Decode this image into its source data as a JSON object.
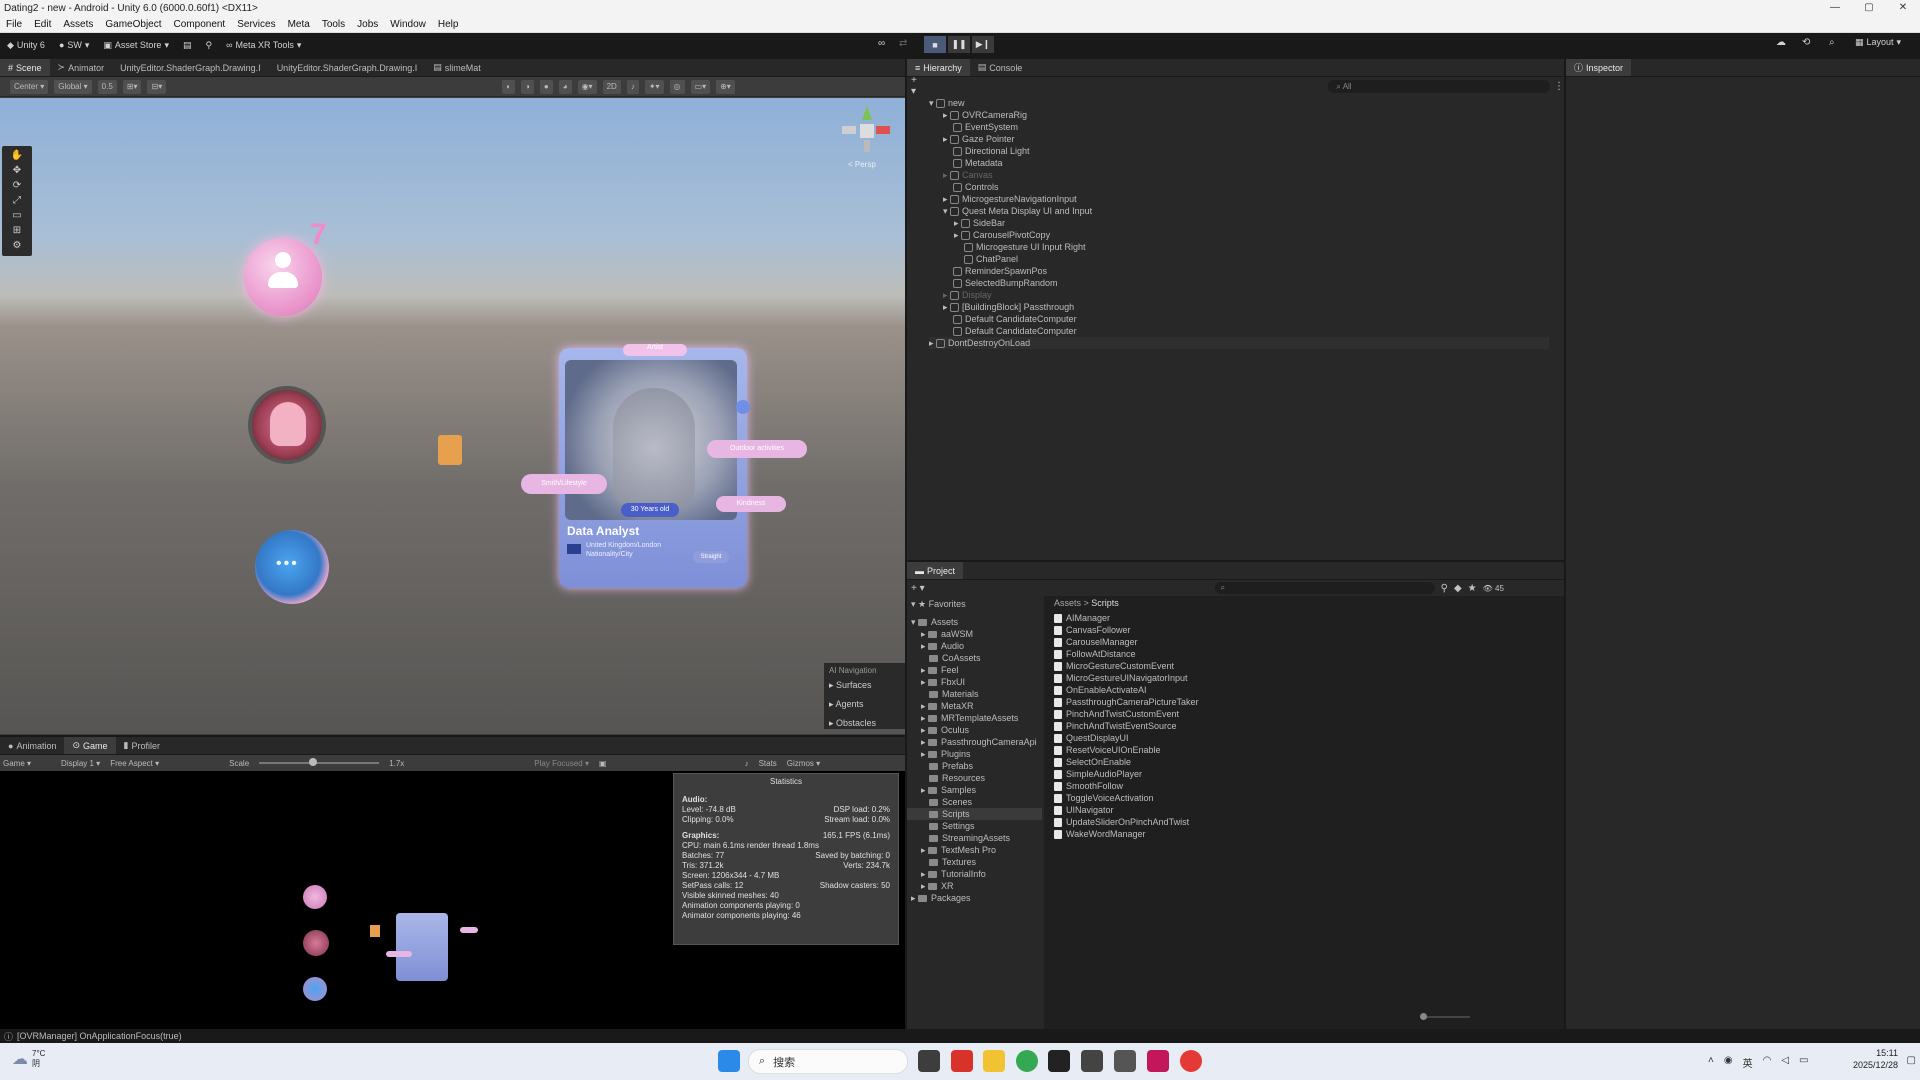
{
  "window": {
    "title": "Dating2 - new - Android - Unity 6.0 (6000.0.60f1) <DX11>",
    "controls": [
      "—",
      "▢",
      "✕"
    ]
  },
  "menu": [
    "File",
    "Edit",
    "Assets",
    "GameObject",
    "Component",
    "Services",
    "Meta",
    "Tools",
    "Jobs",
    "Window",
    "Help"
  ],
  "toolbar": {
    "unity": "Unity 6",
    "account": "SW",
    "asset_store": "Asset Store",
    "meta_xr": "Meta XR Tools",
    "layout": "Layout"
  },
  "scene_tabs": [
    "Scene",
    "Animator",
    "UnityEditor.ShaderGraph.Drawing.I",
    "UnityEditor.ShaderGraph.Drawing.I",
    "slimeMat"
  ],
  "scene_toolbar": {
    "center": "Center",
    "global": "Global",
    "snap": "0.5",
    "mode2d": "2D"
  },
  "gizmo": {
    "persp": "< Persp"
  },
  "scene": {
    "badge_number": "7",
    "card_title": "Data Analyst",
    "card_age": "30 Years old",
    "card_location": "United Kingdom/London",
    "card_nationality": "Nationality/City",
    "card_tag": "Smith/Lifestyle",
    "card_tag2": "Kindness",
    "card_button": "Straight",
    "card_top": "Artist",
    "chip_right": "Outdoor activities"
  },
  "ai_nav": {
    "title": "AI Navigation",
    "items": [
      "Surfaces",
      "Agents",
      "Obstacles"
    ]
  },
  "game_tabs": [
    "Animation",
    "Game",
    "Profiler"
  ],
  "game_toolbar": {
    "mode": "Game",
    "display": "Display 1",
    "aspect": "Free Aspect",
    "scale_label": "Scale",
    "scale_value": "1.7x",
    "play_focused": "Play Focused",
    "stats": "Stats",
    "gizmos": "Gizmos"
  },
  "stats": {
    "title": "Statistics",
    "audio_label": "Audio:",
    "level": "Level: -74.8 dB",
    "clipping": "Clipping: 0.0%",
    "dsp": "DSP load: 0.2%",
    "stream": "Stream load: 0.0%",
    "graphics_label": "Graphics:",
    "fps": "165.1 FPS (6.1ms)",
    "cpu": "CPU: main 6.1ms  render thread 1.8ms",
    "batches": "Batches: 77",
    "saved": "Saved by batching: 0",
    "tris": "Tris: 371.2k",
    "verts": "Verts: 234.7k",
    "screen": "Screen: 1206x344 - 4.7 MB",
    "setpass": "SetPass calls: 12",
    "shadow": "Shadow casters: 50",
    "skinned": "Visible skinned meshes: 40",
    "anim_comp": "Animation components playing: 0",
    "animator_comp": "Animator components playing: 46"
  },
  "hierarchy": {
    "tabs": [
      "Hierarchy",
      "Console"
    ],
    "search": "All",
    "items": [
      {
        "label": "new",
        "depth": 0
      },
      {
        "label": "OVRCameraRig",
        "depth": 1
      },
      {
        "label": "EventSystem",
        "depth": 1
      },
      {
        "label": "Gaze Pointer",
        "depth": 1
      },
      {
        "label": "Directional Light",
        "depth": 1
      },
      {
        "label": "Metadata",
        "depth": 1
      },
      {
        "label": "Canvas",
        "depth": 1
      },
      {
        "label": "Controls",
        "depth": 1
      },
      {
        "label": "MicrogestureNavigationInput",
        "depth": 1
      },
      {
        "label": "Quest Meta Display UI and Input",
        "depth": 1
      },
      {
        "label": "SideBar",
        "depth": 2
      },
      {
        "label": "CarouselPivotCopy",
        "depth": 2
      },
      {
        "label": "Microgesture UI Input Right",
        "depth": 2
      },
      {
        "label": "ChatPanel",
        "depth": 2
      },
      {
        "label": "ReminderSpawnPos",
        "depth": 1
      },
      {
        "label": "SelectedBumpRandom",
        "depth": 1
      },
      {
        "label": "Display",
        "depth": 1
      },
      {
        "label": "[BuildingBlock] Passthrough",
        "depth": 1
      },
      {
        "label": "Default CandidateComputer",
        "depth": 1
      },
      {
        "label": "Default CandidateComputer",
        "depth": 1
      },
      {
        "label": "DontDestroyOnLoad",
        "depth": 0
      }
    ]
  },
  "inspector": {
    "tab": "Inspector"
  },
  "project": {
    "tab": "Project",
    "favorites": "Favorites",
    "breadcrumb": [
      "Assets",
      "Scripts"
    ],
    "count": "45",
    "tree": [
      "Assets",
      "aaWSM",
      "Audio",
      "CoAssets",
      "Feel",
      "FbxUI",
      "Materials",
      "MetaXR",
      "MRTemplateAssets",
      "Oculus",
      "PassthroughCameraApi",
      "Plugins",
      "Prefabs",
      "Resources",
      "Samples",
      "Scenes",
      "Scripts",
      "Settings",
      "StreamingAssets",
      "TextMesh Pro",
      "Textures",
      "TutorialInfo",
      "XR",
      "Packages"
    ],
    "scripts": [
      "AIManager",
      "CanvasFollower",
      "CarouselManager",
      "FollowAtDistance",
      "MicroGestureCustomEvent",
      "MicroGestureUINavigatorInput",
      "OnEnableActivateAI",
      "PassthroughCameraPictureTaker",
      "PinchAndTwistCustomEvent",
      "PinchAndTwistEventSource",
      "QuestDisplayUI",
      "ResetVoiceUIOnEnable",
      "SelectOnEnable",
      "SimpleAudioPlayer",
      "SmoothFollow",
      "ToggleVoiceActivation",
      "UINavigator",
      "UpdateSliderOnPinchAndTwist",
      "WakeWordManager"
    ]
  },
  "status": "[OVRManager] OnApplicationFocus(true)",
  "taskbar": {
    "weather_temp": "7°C",
    "weather_desc": "阴",
    "search": "搜索",
    "time": "15:11",
    "date": "2025/12/28",
    "lang": "英"
  }
}
